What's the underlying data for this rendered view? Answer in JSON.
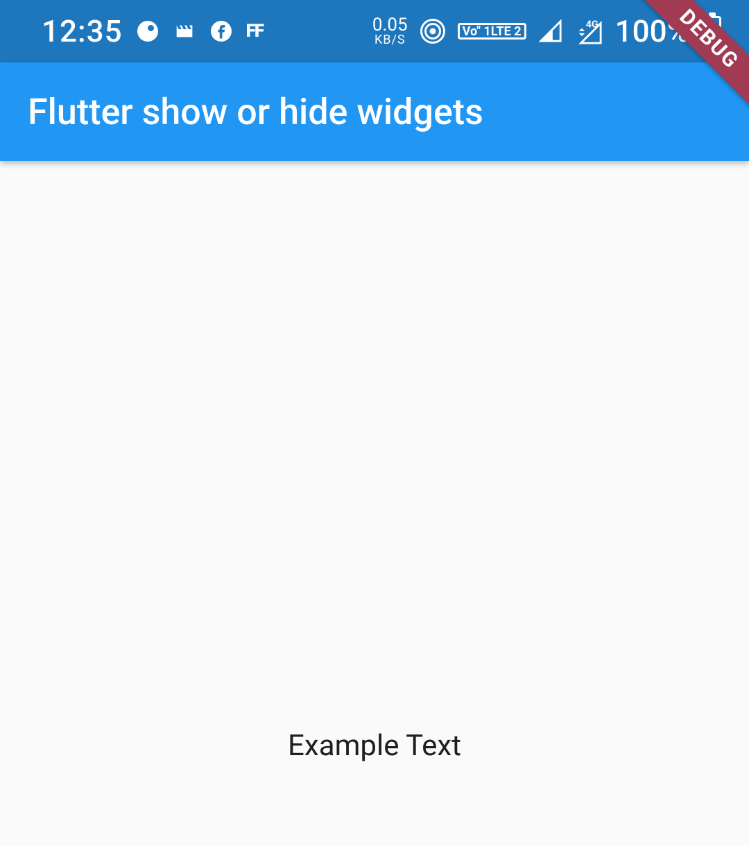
{
  "status_bar": {
    "time": "12:35",
    "data_rate": "0.05",
    "data_unit": "KB/S",
    "volte_line1": "Vo\" 1",
    "volte_line2": "LTE 2",
    "net_label": "4G",
    "battery_pct": "100%",
    "ff_label": "FF"
  },
  "app_bar": {
    "title": "Flutter show or hide widgets"
  },
  "body": {
    "example_text": "Example Text"
  },
  "debug_banner": {
    "label": "DEBUG"
  }
}
